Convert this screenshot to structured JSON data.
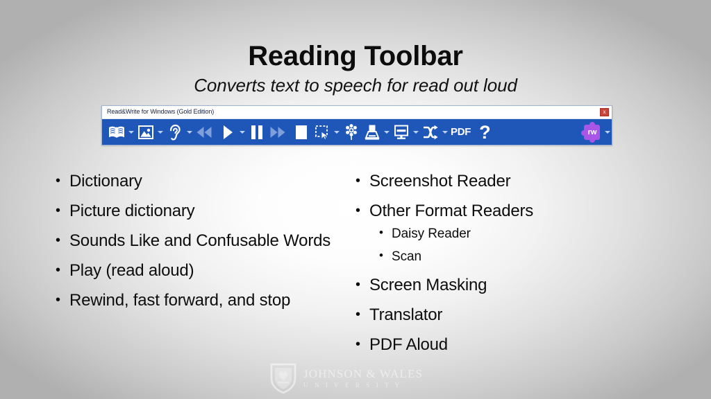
{
  "slide": {
    "title": "Reading Toolbar",
    "subtitle": "Converts text to speech for read out loud",
    "background_center_color": "#ffffff",
    "background_edge_color": "#b0b0b0"
  },
  "rw_window": {
    "title": "Read&Write for Windows (Gold Edition)",
    "close_label": "x",
    "toolbar_color": "#1f57b8",
    "logo_color": "#a855e8",
    "close_color": "#c7443a",
    "toolbar_items": [
      {
        "name": "dictionary",
        "icon": "book-icon",
        "has_caret": true
      },
      {
        "name": "picture-dictionary",
        "icon": "picture-icon",
        "has_caret": true
      },
      {
        "name": "sounds-like-confusable-words",
        "icon": "ear-icon",
        "has_caret": true
      },
      {
        "name": "rewind",
        "icon": "rewind-icon",
        "has_caret": false
      },
      {
        "name": "play",
        "icon": "play-icon",
        "has_caret": true
      },
      {
        "name": "pause",
        "icon": "pause-icon",
        "has_caret": false
      },
      {
        "name": "fast-forward",
        "icon": "fast-forward-icon",
        "has_caret": false
      },
      {
        "name": "stop",
        "icon": "stop-icon",
        "has_caret": false
      },
      {
        "name": "screenshot-reader",
        "icon": "screenshot-reader-icon",
        "has_caret": true
      },
      {
        "name": "settings",
        "icon": "gear-icon",
        "has_caret": false
      },
      {
        "name": "scan",
        "icon": "scanner-icon",
        "has_caret": true
      },
      {
        "name": "screen-masking",
        "icon": "screen-masking-icon",
        "has_caret": true
      },
      {
        "name": "translator",
        "icon": "translator-icon",
        "has_caret": true
      },
      {
        "name": "pdf-aloud",
        "icon": "pdf-label",
        "label": "PDF",
        "has_caret": false
      },
      {
        "name": "help",
        "icon": "question-mark-icon",
        "label": "?",
        "has_caret": false
      },
      {
        "name": "rw-logo",
        "icon": "rw-puzzle-icon",
        "label": "rw",
        "has_caret": true
      }
    ],
    "pdf_label": "PDF",
    "help_label": "?",
    "logo_label": "rw"
  },
  "left_column": [
    {
      "text": "Dictionary"
    },
    {
      "text": "Picture dictionary"
    },
    {
      "text": "Sounds Like and Confusable Words"
    },
    {
      "text": "Play (read aloud)"
    },
    {
      "text": "Rewind, fast forward, and stop"
    }
  ],
  "right_column": [
    {
      "text": "Screenshot Reader",
      "children": []
    },
    {
      "text": "Other Format Readers",
      "children": [
        {
          "text": "Daisy Reader"
        },
        {
          "text": "Scan"
        }
      ]
    },
    {
      "text": "Screen Masking",
      "children": []
    },
    {
      "text": "Translator",
      "children": []
    },
    {
      "text": "PDF Aloud",
      "children": []
    }
  ],
  "watermark": {
    "name": "JOHNSON & WALES",
    "subtitle": "U N I V E R S I T Y"
  }
}
